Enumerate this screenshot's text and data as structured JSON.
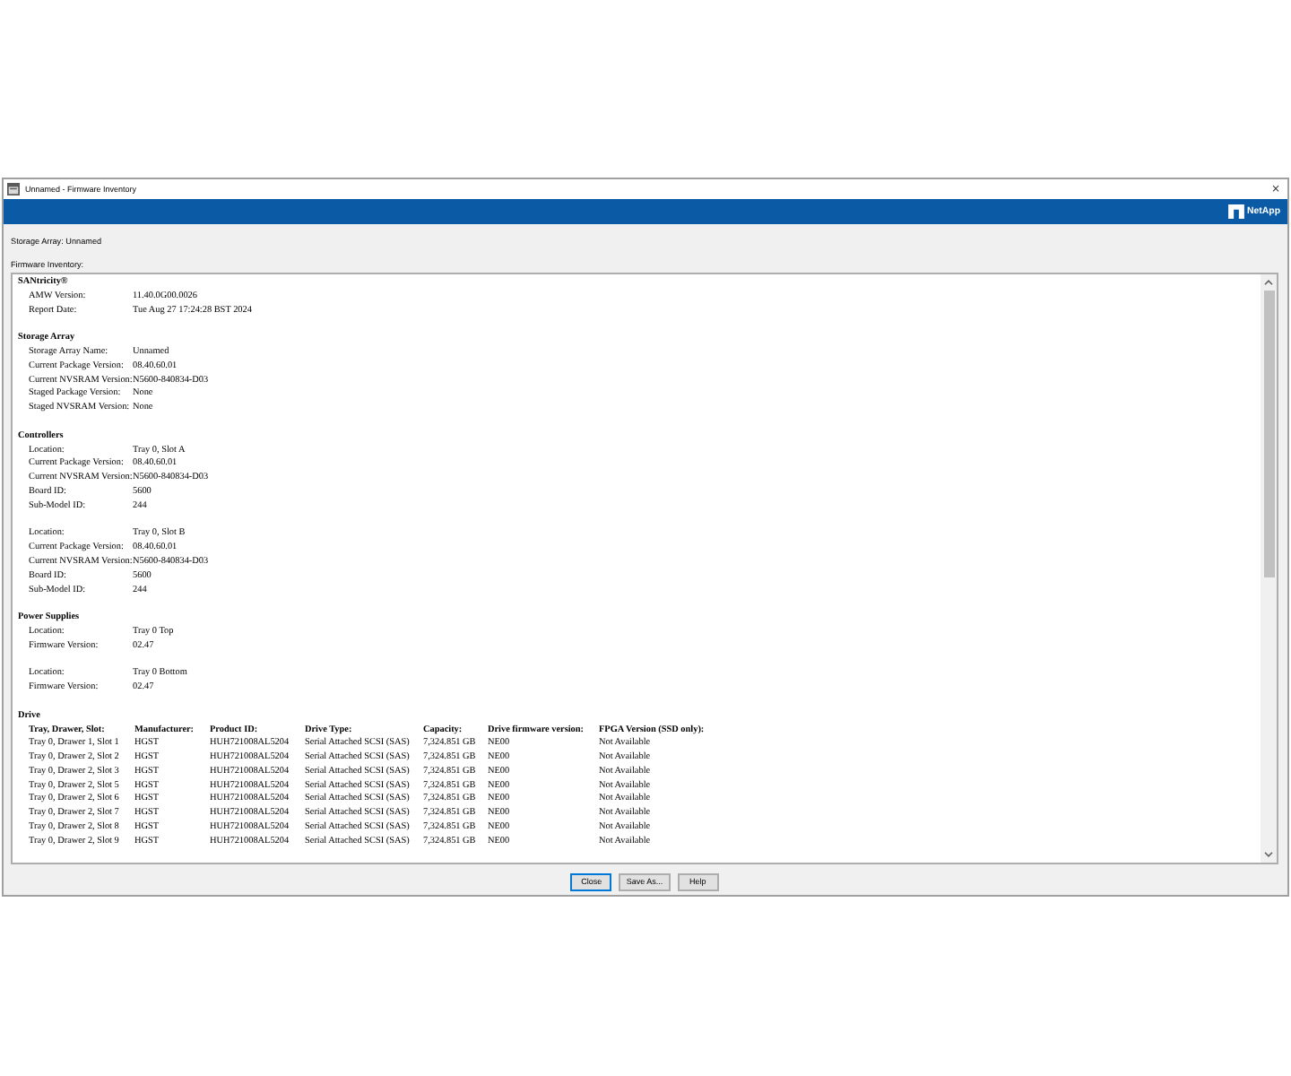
{
  "window": {
    "title": "Unnamed - Firmware Inventory",
    "close_glyph": "×"
  },
  "banner": {
    "logo_text": "NetApp"
  },
  "storage_array": "Storage Array: Unnamed",
  "inventory_heading": "Firmware Inventory:",
  "report": [
    {
      "kind": "fields",
      "title": "SANtricity®",
      "groups": [
        [
          {
            "label": "AMW Version:",
            "value": "11.40.0G00.0026"
          },
          {
            "label": "Report Date:",
            "value": "Tue Aug 27 17:24:28 BST 2024"
          }
        ]
      ]
    },
    {
      "kind": "fields",
      "title": "Storage Array",
      "groups": [
        [
          {
            "label": "Storage Array Name:",
            "value": "Unnamed"
          },
          {
            "label": "Current Package Version:",
            "value": "08.40.60.01"
          },
          {
            "label": "Current NVSRAM Version:",
            "value": "N5600-840834-D03"
          },
          {
            "label": "Staged Package Version:",
            "value": "None"
          },
          {
            "label": "Staged NVSRAM Version:",
            "value": "None"
          }
        ]
      ]
    },
    {
      "kind": "fields",
      "title": "Controllers",
      "groups": [
        [
          {
            "label": "Location:",
            "value": "Tray 0, Slot A"
          },
          {
            "label": "Current Package Version:",
            "value": "08.40.60.01"
          },
          {
            "label": "Current NVSRAM Version:",
            "value": "N5600-840834-D03"
          },
          {
            "label": "Board ID:",
            "value": "5600"
          },
          {
            "label": "Sub-Model ID:",
            "value": "244"
          }
        ],
        [
          {
            "label": "Location:",
            "value": "Tray 0, Slot B"
          },
          {
            "label": "Current Package Version:",
            "value": "08.40.60.01"
          },
          {
            "label": "Current NVSRAM Version:",
            "value": "N5600-840834-D03"
          },
          {
            "label": "Board ID:",
            "value": "5600"
          },
          {
            "label": "Sub-Model ID:",
            "value": "244"
          }
        ]
      ]
    },
    {
      "kind": "fields",
      "title": "Power Supplies",
      "groups": [
        [
          {
            "label": "Location:",
            "value": "Tray 0 Top"
          },
          {
            "label": "Firmware Version:",
            "value": "02.47"
          }
        ],
        [
          {
            "label": "Location:",
            "value": "Tray 0 Bottom"
          },
          {
            "label": "Firmware Version:",
            "value": "02.47"
          }
        ]
      ]
    },
    {
      "kind": "table",
      "title": "Drive",
      "columns": [
        "Tray, Drawer, Slot:",
        "Manufacturer:",
        "Product ID:",
        "Drive Type:",
        "Capacity:",
        "Drive firmware version:",
        "FPGA Version (SSD only):"
      ],
      "rows": [
        [
          "Tray 0, Drawer 1, Slot 1",
          "HGST",
          "HUH721008AL5204",
          "Serial Attached SCSI (SAS)",
          "7,324.851 GB",
          "NE00",
          "Not Available"
        ],
        [
          "Tray 0, Drawer 2, Slot 2",
          "HGST",
          "HUH721008AL5204",
          "Serial Attached SCSI (SAS)",
          "7,324.851 GB",
          "NE00",
          "Not Available"
        ],
        [
          "Tray 0, Drawer 2, Slot 3",
          "HGST",
          "HUH721008AL5204",
          "Serial Attached SCSI (SAS)",
          "7,324.851 GB",
          "NE00",
          "Not Available"
        ],
        [
          "Tray 0, Drawer 2, Slot 5",
          "HGST",
          "HUH721008AL5204",
          "Serial Attached SCSI (SAS)",
          "7,324.851 GB",
          "NE00",
          "Not Available"
        ],
        [
          "Tray 0, Drawer 2, Slot 6",
          "HGST",
          "HUH721008AL5204",
          "Serial Attached SCSI (SAS)",
          "7,324.851 GB",
          "NE00",
          "Not Available"
        ],
        [
          "Tray 0, Drawer 2, Slot 7",
          "HGST",
          "HUH721008AL5204",
          "Serial Attached SCSI (SAS)",
          "7,324.851 GB",
          "NE00",
          "Not Available"
        ],
        [
          "Tray 0, Drawer 2, Slot 8",
          "HGST",
          "HUH721008AL5204",
          "Serial Attached SCSI (SAS)",
          "7,324.851 GB",
          "NE00",
          "Not Available"
        ],
        [
          "Tray 0, Drawer 2, Slot 9",
          "HGST",
          "HUH721008AL5204",
          "Serial Attached SCSI (SAS)",
          "7,324.851 GB",
          "NE00",
          "Not Available"
        ]
      ]
    }
  ],
  "buttons": [
    {
      "label": "Close",
      "focused": true
    },
    {
      "label": "Save As...",
      "focused": false
    },
    {
      "label": "Help",
      "focused": false
    }
  ]
}
